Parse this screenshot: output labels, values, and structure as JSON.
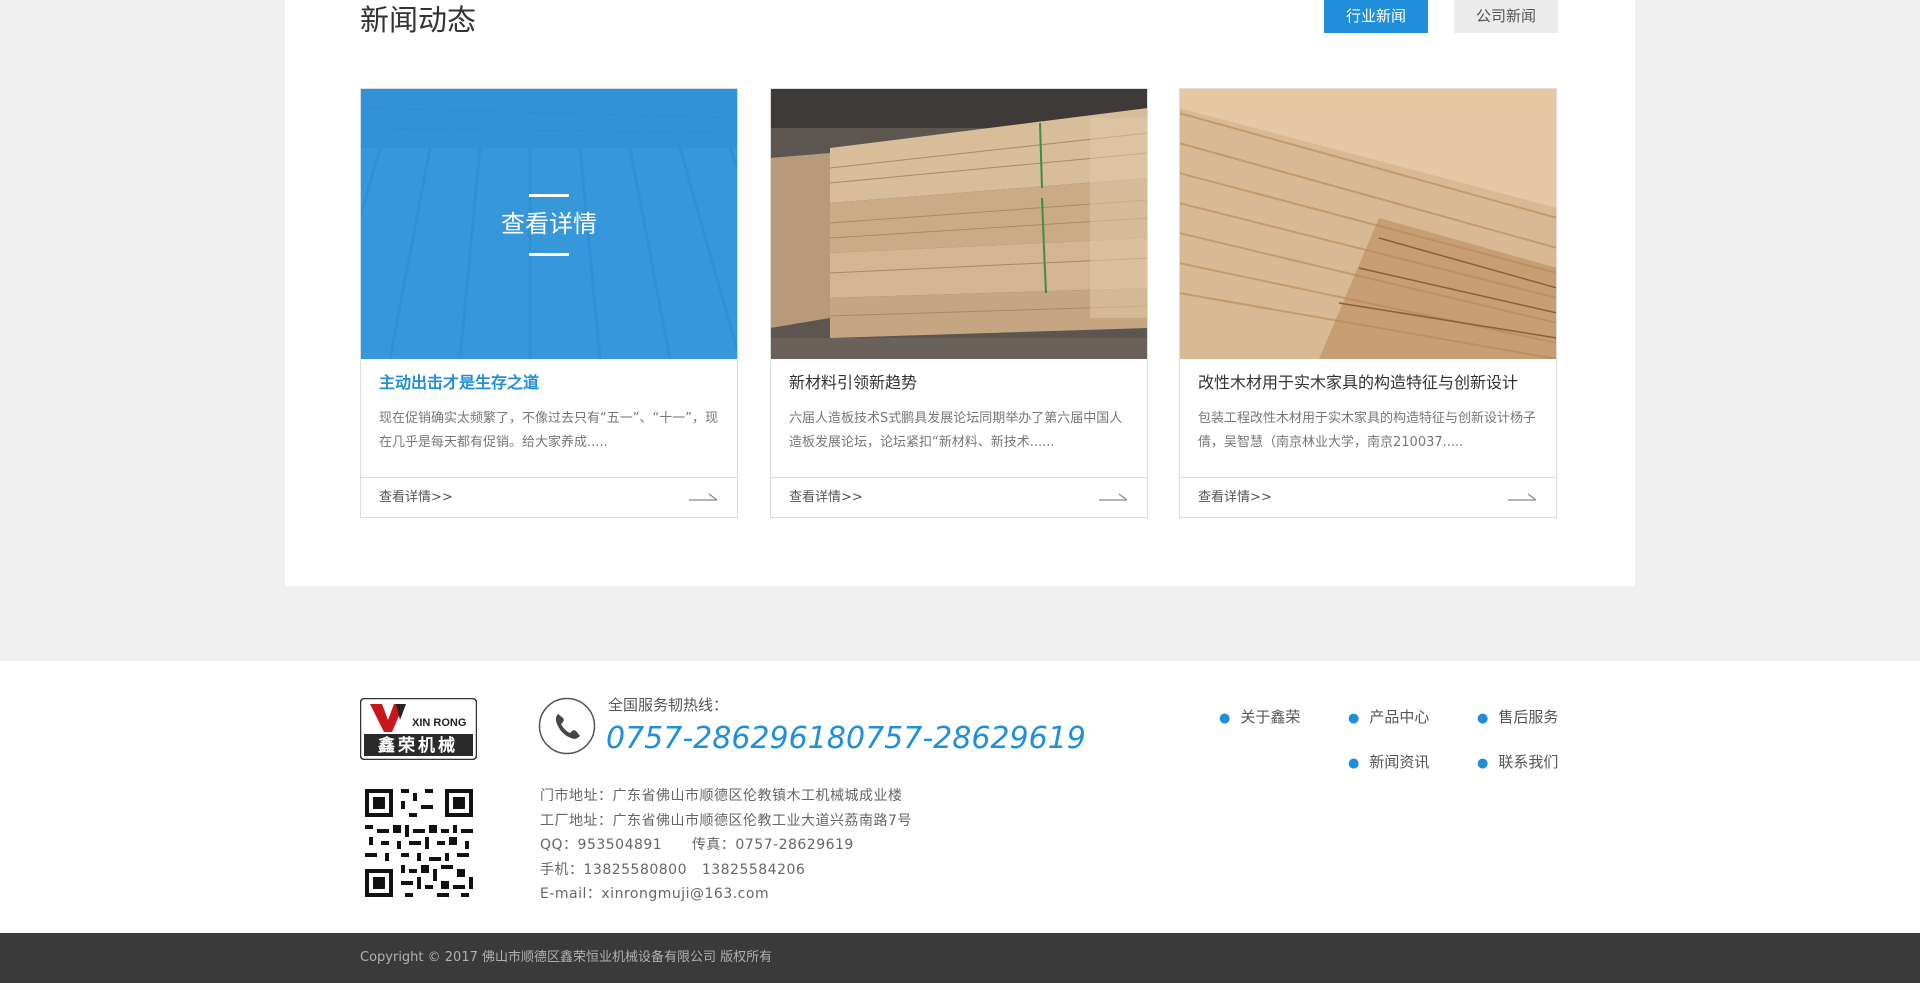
{
  "news_section": {
    "title": "新闻动态",
    "tabs": [
      {
        "label": "行业新闻",
        "active": true
      },
      {
        "label": "公司新闻",
        "active": false
      }
    ],
    "hover_overlay_text": "查看详情",
    "cards": [
      {
        "title": "主动出击才是生存之道",
        "description": "现在促销确实太频繁了，不像过去只有“五一”、“十一”，现在几乎是每天都有促销。给大家养成.....",
        "link": "查看详情>>"
      },
      {
        "title": "新材料引领新趋势",
        "description": "六届人造板技术S式鹏具发展论坛同期举办了第六届中国人造板发展论坛，论坛紧扣“新材料、新技术......",
        "link": "查看详情>>"
      },
      {
        "title": "改性木材用于实木家具的构造特征与创新设计",
        "description": "包装工程改性木材用于实木家具的构造特征与创新设计杨子倩，吴智慧（南京林业大学，南京210037.....",
        "link": "查看详情>>"
      }
    ]
  },
  "footer": {
    "logo_text_top": "XIN RONG",
    "logo_text_bottom": "鑫荣机械",
    "hotline_label": "全国服务韧热线：",
    "hotline_numbers": [
      "0757-28629618",
      "0757-28629619"
    ],
    "contact_lines": [
      "门市地址：广东省佛山市顺德区伦教镇木工机械城成业楼",
      "工厂地址：广东省佛山市顺德区伦教工业大道兴荔南路7号",
      "QQ：953504891      传真：0757-28629619",
      "手机：13825580800   13825584206",
      "E-mail：xinrongmuji@163.com"
    ],
    "nav": [
      {
        "label": "关于鑫荣"
      },
      {
        "label": "产品中心"
      },
      {
        "label": "售后服务"
      },
      {
        "label": "新闻资讯"
      },
      {
        "label": "联系我们"
      }
    ],
    "copyright": "Copyright © 2017  佛山市顺德区鑫荣恒业机械设备有限公司 版权所有"
  },
  "colors": {
    "accent": "#1f8fdc",
    "page_background": "#f0f0f0",
    "bottom_bar": "#3a3a3a"
  }
}
